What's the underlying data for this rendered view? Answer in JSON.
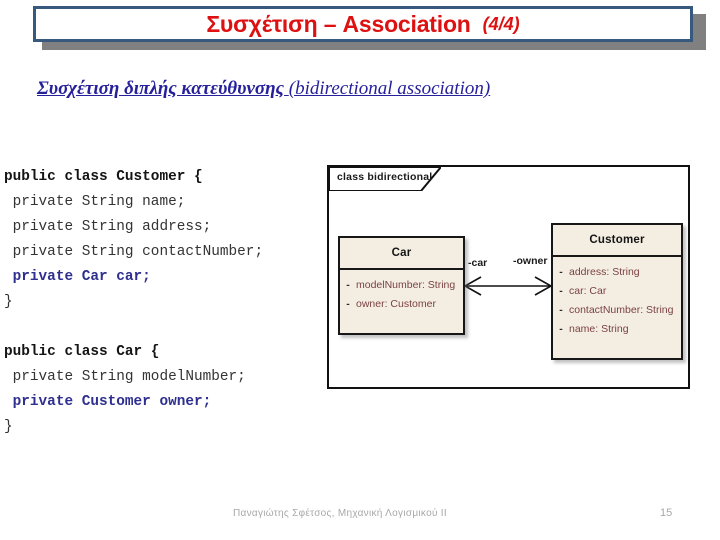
{
  "slide": {
    "title": "Συσχέτιση – Association",
    "title_counter": "(4/4)",
    "subtitle_gr": "Συσχέτιση διπλής κατεύθυνσης",
    "subtitle_en": "(bidirectional association)",
    "title_color": "#dd1111",
    "subtitle_color": "#26209b",
    "title_border_color": "#36597d"
  },
  "code": {
    "lines": [
      {
        "text": "public class Customer {",
        "style": "kw"
      },
      {
        "text": " private String name;",
        "style": "plain"
      },
      {
        "text": " private String address;",
        "style": "plain"
      },
      {
        "text": " private String contactNumber;",
        "style": "plain"
      },
      {
        "text": " private Car car;",
        "style": "hl"
      },
      {
        "text": "}",
        "style": "plain"
      },
      {
        "text": "",
        "style": "blank"
      },
      {
        "text": "public class Car {",
        "style": "kw"
      },
      {
        "text": " private String modelNumber;",
        "style": "plain"
      },
      {
        "text": " private Customer owner;",
        "style": "hl"
      },
      {
        "text": "}",
        "style": "plain"
      }
    ],
    "highlight_color": "#2f2f8f",
    "plain_color": "#333333"
  },
  "diagram": {
    "frame_label": "class bidirectional",
    "fill_color": "#f4eee2",
    "classes": [
      {
        "name": "Car",
        "attributes": [
          {
            "visibility": "-",
            "text": "modelNumber: String"
          },
          {
            "visibility": "-",
            "text": "owner: Customer"
          }
        ]
      },
      {
        "name": "Customer",
        "attributes": [
          {
            "visibility": "-",
            "text": "address: String"
          },
          {
            "visibility": "-",
            "text": "car: Car"
          },
          {
            "visibility": "-",
            "text": "contactNumber: String"
          },
          {
            "visibility": "-",
            "text": "name: String"
          }
        ]
      }
    ],
    "association": {
      "role_left": "-car",
      "role_right": "-owner",
      "kind": "bidirectional"
    }
  },
  "footer": {
    "author_course": "Παναγιώτης Σφέτσος,  Μηχανική Λογισμικού ΙΙ",
    "page_number": "15"
  }
}
